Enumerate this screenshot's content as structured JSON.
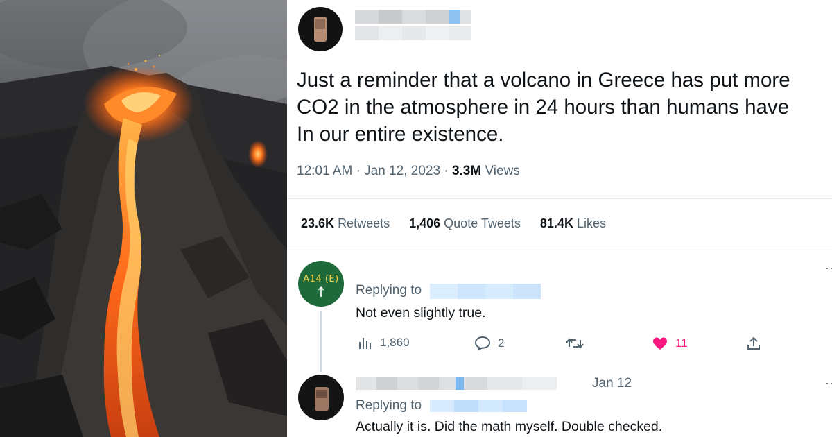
{
  "photo": {
    "subject": "volcano-lava-photo"
  },
  "tweet": {
    "text": "Just a reminder that a volcano in Greece has put more\nCO2 in the atmosphere in 24 hours than humans have\nIn our entire existence.",
    "time": "12:01 AM",
    "date": "Jan 12, 2023",
    "views_count": "3.3M",
    "views_label": "Views",
    "retweets_count": "23.6K",
    "retweets_label": "Retweets",
    "quotes_count": "1,406",
    "quotes_label": "Quote Tweets",
    "likes_count": "81.4K",
    "likes_label": "Likes"
  },
  "reply1": {
    "avatar_sign": "A14 (E)",
    "avatar_arrow": "↑",
    "replying_to": "Replying to",
    "text": "Not even slightly true.",
    "views": "1,860",
    "replies": "2",
    "likes": "11"
  },
  "reply2": {
    "date": "Jan 12",
    "replying_to": "Replying to",
    "text": "Actually it is. Did the math myself. Double checked."
  },
  "colors": {
    "text": "#0f1419",
    "secondary": "#536471",
    "like_pink": "#f91880",
    "blur_blue": "#79b8f2"
  }
}
